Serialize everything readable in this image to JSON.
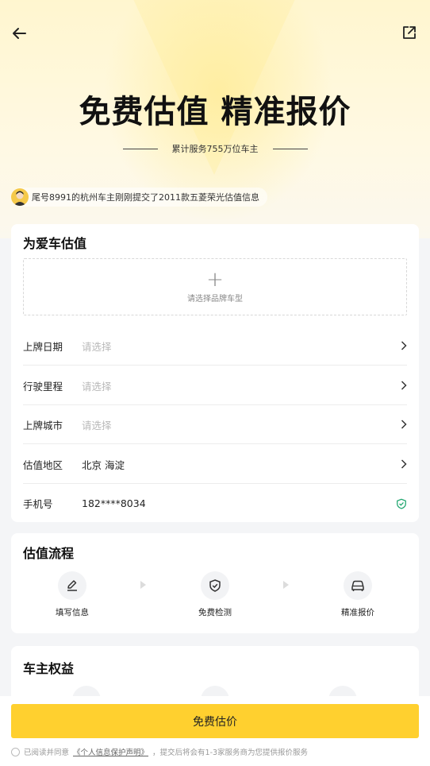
{
  "hero": {
    "title": "免费估值 精准报价",
    "subtitle": "累计服务755万位车主",
    "ticker": "尾号8991的杭州车主刚刚提交了2011款五菱荣光估值信息"
  },
  "icons": {
    "back": "arrow-left-icon",
    "share": "share-icon",
    "chevron": "chevron-right-icon",
    "shield": "shield-check-icon"
  },
  "valuation": {
    "title": "为爱车估值",
    "picker_hint": "请选择品牌车型",
    "rows": [
      {
        "label": "上牌日期",
        "value": "请选择"
      },
      {
        "label": "行驶里程",
        "value": "请选择"
      },
      {
        "label": "上牌城市",
        "value": "请选择"
      },
      {
        "label": "估值地区",
        "value": "北京 海淀"
      },
      {
        "label": "手机号",
        "value": "182****8034"
      }
    ]
  },
  "process": {
    "title": "估值流程",
    "steps": [
      {
        "label": "填写信息",
        "icon": "edit-icon"
      },
      {
        "label": "免费检测",
        "icon": "shield-icon"
      },
      {
        "label": "精准报价",
        "icon": "car-icon"
      }
    ]
  },
  "benefits": {
    "title": "车主权益"
  },
  "footer": {
    "cta": "免费估价",
    "agree_prefix": "已阅读并同意",
    "agree_link": "《个人信息保护声明》",
    "agree_suffix": "，提交后将会有1-3家服务商为您提供报价服务"
  },
  "colors": {
    "accent": "#ffd02f",
    "shield_green": "#1aa36b",
    "placeholder": "#b9b9b9"
  }
}
